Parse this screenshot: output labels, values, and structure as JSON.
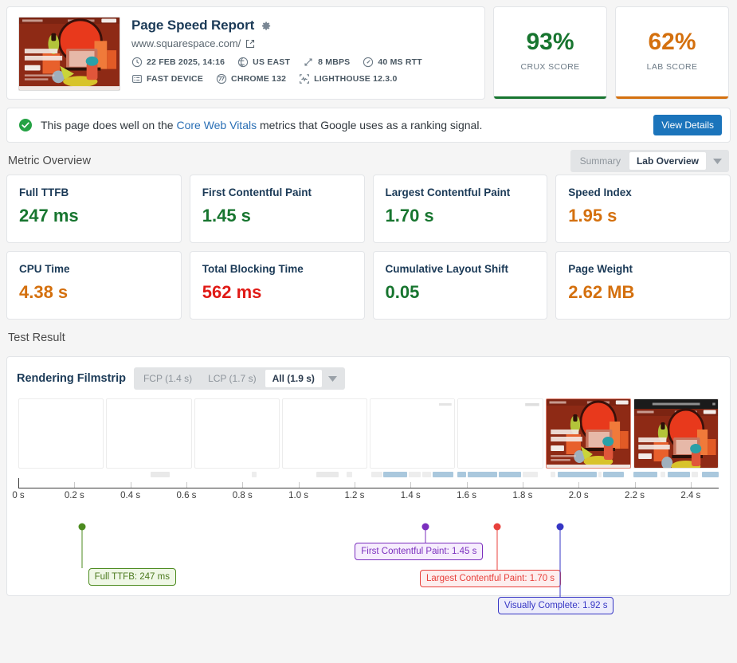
{
  "report": {
    "title": "Page Speed Report",
    "url": "www.squarespace.com/",
    "meta": [
      {
        "icon": "clock-icon",
        "label": "22 FEB 2025, 14:16"
      },
      {
        "icon": "globe-icon",
        "label": "US EAST"
      },
      {
        "icon": "bandwidth-icon",
        "label": "8 MBPS"
      },
      {
        "icon": "latency-icon",
        "label": "40 MS RTT"
      },
      {
        "icon": "device-icon",
        "label": "FAST DEVICE"
      },
      {
        "icon": "chrome-icon",
        "label": "CHROME 132"
      },
      {
        "icon": "lighthouse-icon",
        "label": "LIGHTHOUSE 12.3.0"
      }
    ]
  },
  "scores": [
    {
      "value": "93%",
      "label": "CRUX SCORE",
      "color": "#17752f"
    },
    {
      "value": "62%",
      "label": "LAB SCORE",
      "color": "#d4700e"
    }
  ],
  "banner": {
    "text_before": "This page does well on the ",
    "link": "Core Web Vitals",
    "text_after": " metrics that Google uses as a ranking signal.",
    "button": "View Details",
    "status_color": "#25a244"
  },
  "metric_overview": {
    "heading": "Metric Overview",
    "toggle": {
      "options": [
        "Summary",
        "Lab Overview"
      ],
      "selected": "Lab Overview"
    },
    "cards": [
      {
        "name": "Full TTFB",
        "value": "247 ms",
        "color": "#17752f"
      },
      {
        "name": "First Contentful Paint",
        "value": "1.45 s",
        "color": "#17752f"
      },
      {
        "name": "Largest Contentful Paint",
        "value": "1.70 s",
        "color": "#17752f"
      },
      {
        "name": "Speed Index",
        "value": "1.95 s",
        "color": "#d4700e"
      },
      {
        "name": "CPU Time",
        "value": "4.38 s",
        "color": "#d4700e"
      },
      {
        "name": "Total Blocking Time",
        "value": "562 ms",
        "color": "#e01b17"
      },
      {
        "name": "Cumulative Layout Shift",
        "value": "0.05",
        "color": "#17752f"
      },
      {
        "name": "Page Weight",
        "value": "2.62 MB",
        "color": "#d4700e"
      }
    ]
  },
  "test_result": {
    "heading": "Test Result",
    "filmstrip": {
      "title": "Rendering Filmstrip",
      "filters": [
        {
          "label": "FCP (1.4 s)",
          "active": false
        },
        {
          "label": "LCP (1.7 s)",
          "active": false
        },
        {
          "label": "All (1.9 s)",
          "active": true
        }
      ]
    }
  },
  "chart_data": {
    "type": "timeline",
    "title": "Rendering Filmstrip",
    "xlabel": "",
    "xlim": [
      0,
      2.5
    ],
    "tick_labels": [
      "0 s",
      "0.2 s",
      "0.4 s",
      "0.6 s",
      "0.8 s",
      "1.0 s",
      "1.2 s",
      "1.4 s",
      "1.6 s",
      "1.8 s",
      "2.0 s",
      "2.2 s",
      "2.4 s"
    ],
    "tick_values": [
      0,
      0.2,
      0.4,
      0.6,
      0.8,
      1.0,
      1.2,
      1.4,
      1.6,
      1.8,
      2.0,
      2.2,
      2.4
    ],
    "grid": true,
    "markers": [
      {
        "name": "Full TTFB",
        "label": "Full TTFB: 247 ms",
        "time": 0.247,
        "color": "#4c8b1f",
        "bg": "#eff7e6",
        "text": "#4c7a1f"
      },
      {
        "name": "First Contentful Paint",
        "label": "First Contentful Paint: 1.45 s",
        "time": 1.45,
        "color": "#7b2fbe",
        "bg": "#f6edfd",
        "text": "#7b2fbe"
      },
      {
        "name": "Largest Contentful Paint",
        "label": "Largest Contentful Paint: 1.70 s",
        "time": 1.7,
        "color": "#e8413c",
        "bg": "#fdeeee",
        "text": "#e8413c"
      },
      {
        "name": "Visually Complete",
        "label": "Visually Complete: 1.92 s",
        "time": 1.92,
        "color": "#3636c4",
        "bg": "#ececfb",
        "text": "#3636c4"
      }
    ],
    "frames": [
      {
        "index": 0,
        "state": "blank"
      },
      {
        "index": 1,
        "state": "blank"
      },
      {
        "index": 2,
        "state": "blank"
      },
      {
        "index": 3,
        "state": "blank"
      },
      {
        "index": 4,
        "state": "blank"
      },
      {
        "index": 5,
        "state": "partial"
      },
      {
        "index": 6,
        "state": "rendered",
        "highlight": true
      },
      {
        "index": 7,
        "state": "rendered-banner"
      }
    ]
  }
}
